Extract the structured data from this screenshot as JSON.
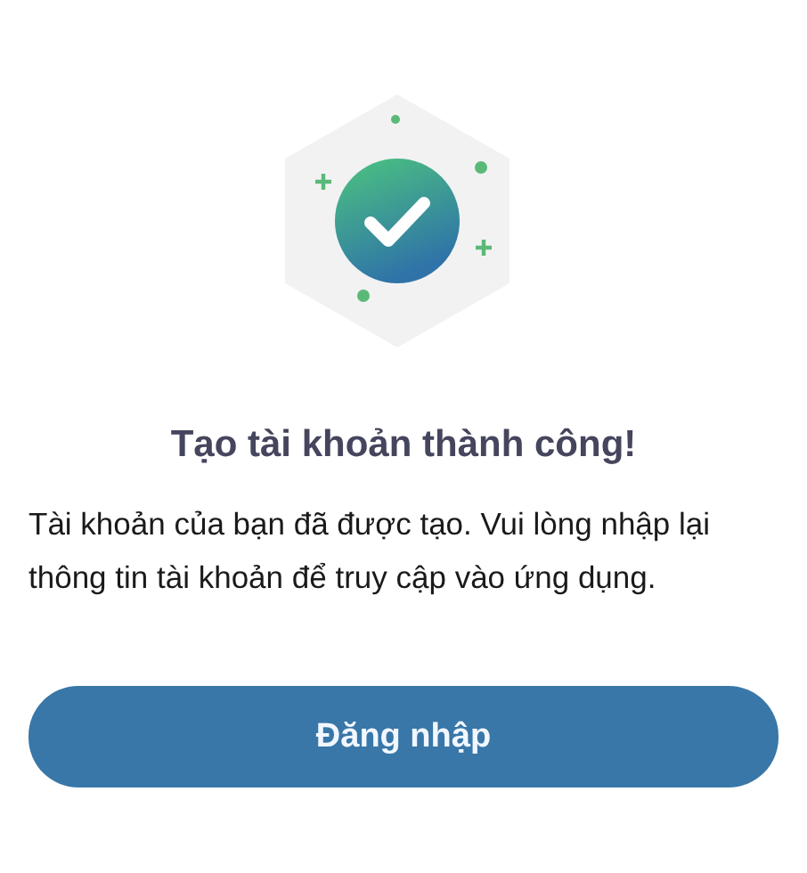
{
  "title": "Tạo tài khoản thành công!",
  "message": "Tài khoản của bạn đã được tạo. Vui lòng nhập lại thông tin tài khoản để truy cập vào ứng dụng.",
  "button": "Đăng nhập"
}
